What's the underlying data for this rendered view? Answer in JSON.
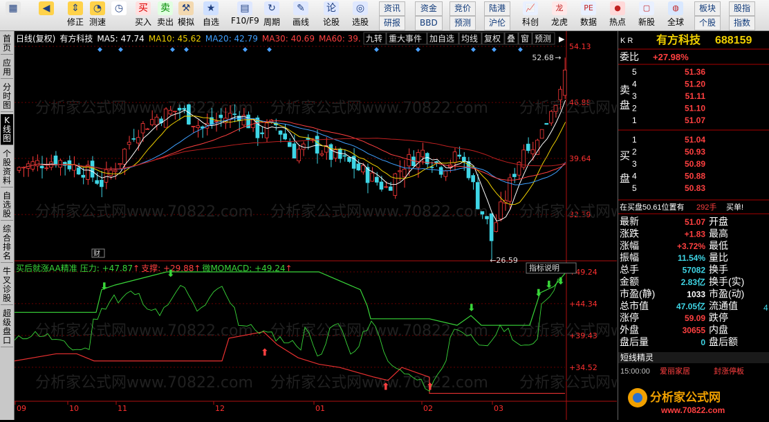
{
  "toolbar": {
    "buttons": [
      {
        "label": "",
        "icon": "windows-icon"
      },
      {
        "label": "",
        "icon": "back-arrow-icon"
      },
      {
        "label": "修正",
        "icon": "arrow-up-down-icon"
      },
      {
        "label": "测速",
        "icon": "speed-icon"
      },
      {
        "label": "",
        "icon": "clock-icon"
      },
      {
        "label": "买入",
        "icon": "buy-icon"
      },
      {
        "label": "卖出",
        "icon": "sell-icon"
      },
      {
        "label": "模拟",
        "icon": "hammer-icon"
      },
      {
        "label": "自选",
        "icon": "star-icon"
      },
      {
        "label": "F10/F9",
        "icon": "f10-icon"
      },
      {
        "label": "周期",
        "icon": "period-icon"
      },
      {
        "label": "画线",
        "icon": "pen-icon"
      },
      {
        "label": "论股",
        "icon": "talk-icon"
      },
      {
        "label": "选股",
        "icon": "select-icon"
      }
    ],
    "groups": [
      [
        "资讯",
        "研报"
      ],
      [
        "资金",
        "BBD"
      ],
      [
        "竞价",
        "预测"
      ],
      [
        "陆港",
        "沪伦"
      ]
    ],
    "buttons2": [
      {
        "label": "科创",
        "icon": "chart-icon"
      },
      {
        "label": "龙虎",
        "icon": "dragon-icon"
      },
      {
        "label": "数据",
        "icon": "pe-icon"
      },
      {
        "label": "热点",
        "icon": "hot-icon"
      },
      {
        "label": "新股",
        "icon": "newstock-icon"
      },
      {
        "label": "全球",
        "icon": "globe-icon"
      }
    ],
    "groups2": [
      [
        "板块",
        "个股"
      ],
      [
        "股指",
        "指数"
      ]
    ]
  },
  "leftnav": [
    "首页",
    "应用",
    "分时图",
    "K线图",
    "个股资料",
    "自选股",
    "综合排名",
    "牛叉诊股",
    "超级盘口"
  ],
  "chart": {
    "header_left": "日线(复权)",
    "stock": "有方科技",
    "ma": [
      {
        "label": "MA5: 47.74",
        "color": "#ffffff"
      },
      {
        "label": "MA10: 45.62",
        "color": "#f0d000"
      },
      {
        "label": "MA20: 42.79",
        "color": "#3fa0ff"
      },
      {
        "label": "MA30: 40.69",
        "color": "#ff4040"
      },
      {
        "label": "MA60: 39.",
        "color": "#ff4040"
      }
    ],
    "tabs": [
      "九转",
      "重大事件",
      "加自选",
      "均线",
      "复权",
      "叠",
      "窗",
      "预测"
    ],
    "price_ticks": [
      "54.13",
      "46.88",
      "39.64",
      "32.39"
    ],
    "high_label": "52.68",
    "low_label": "26.59",
    "marker": "财",
    "watermark": "分析家公式网www.70822.com",
    "indicator_title": "买后就涨AA精准",
    "indicator_values": [
      "压力: +47.87",
      "支撑: +29.88",
      "微MOMACD: +49.24"
    ],
    "indicator_btn": "指标说明",
    "ind_ticks": [
      "+49.24",
      "+44.34",
      "+39.43",
      "+34.52"
    ],
    "x_labels": [
      "09",
      "10",
      "11",
      "12",
      "01",
      "02",
      "03"
    ],
    "colors": {
      "up": "#ff3a3a",
      "down": "#3fd6e6",
      "green": "#39d639",
      "red": "#e83030",
      "axis": "#b01010"
    }
  },
  "right": {
    "code": "K R",
    "name": "有方科技",
    "id": "688159",
    "weibi_label": "委比",
    "weibi_value": "+27.98%",
    "sell_label": "卖盘",
    "buy_label": "买盘",
    "sell": [
      {
        "n": "5",
        "p": "51.36"
      },
      {
        "n": "4",
        "p": "51.20"
      },
      {
        "n": "3",
        "p": "51.11"
      },
      {
        "n": "2",
        "p": "51.10"
      },
      {
        "n": "1",
        "p": "51.07"
      }
    ],
    "buy": [
      {
        "n": "1",
        "p": "51.04"
      },
      {
        "n": "2",
        "p": "50.93"
      },
      {
        "n": "3",
        "p": "50.89"
      },
      {
        "n": "4",
        "p": "50.88"
      },
      {
        "n": "5",
        "p": "50.83"
      }
    ],
    "status": "在买盘50.61位置有",
    "status_hand": "292手",
    "status_act": "买单!",
    "quote": [
      {
        "l": "最新",
        "v": "51.07",
        "c": "#ff4040",
        "l2": "开盘"
      },
      {
        "l": "涨跌",
        "v": "+1.83",
        "c": "#ff4040",
        "l2": "最高"
      },
      {
        "l": "涨幅",
        "v": "+3.72%",
        "c": "#ff4040",
        "l2": "最低"
      },
      {
        "l": "振幅",
        "v": "11.54%",
        "c": "#3fd6e6",
        "l2": "量比"
      },
      {
        "l": "总手",
        "v": "57082",
        "c": "#3fd6e6",
        "l2": "换手"
      },
      {
        "l": "金额",
        "v": "2.83亿",
        "c": "#3fd6e6",
        "l2": "换手(实)"
      },
      {
        "l": "市盈(静)",
        "v": "1033",
        "c": "#ffffff",
        "l2": "市盈(动)"
      },
      {
        "l": "总市值",
        "v": "47.05亿",
        "c": "#3fd6e6",
        "l2": "流通值"
      },
      {
        "l": "涨停",
        "v": "59.09",
        "c": "#ff4040",
        "l2": "跌停"
      },
      {
        "l": "外盘",
        "v": "30655",
        "c": "#ff4040",
        "l2": "内盘"
      },
      {
        "l": "盘后量",
        "v": "0",
        "c": "#3fd6e6",
        "l2": "盘后额"
      }
    ],
    "partial": "4",
    "short_title": "短线精灵",
    "short_rows": [
      {
        "t": "15:00:00",
        "s": "爱丽家居",
        "e": "封涨停板"
      }
    ],
    "logo": "分析家公式网",
    "logo_url": "www.70822.com"
  }
}
